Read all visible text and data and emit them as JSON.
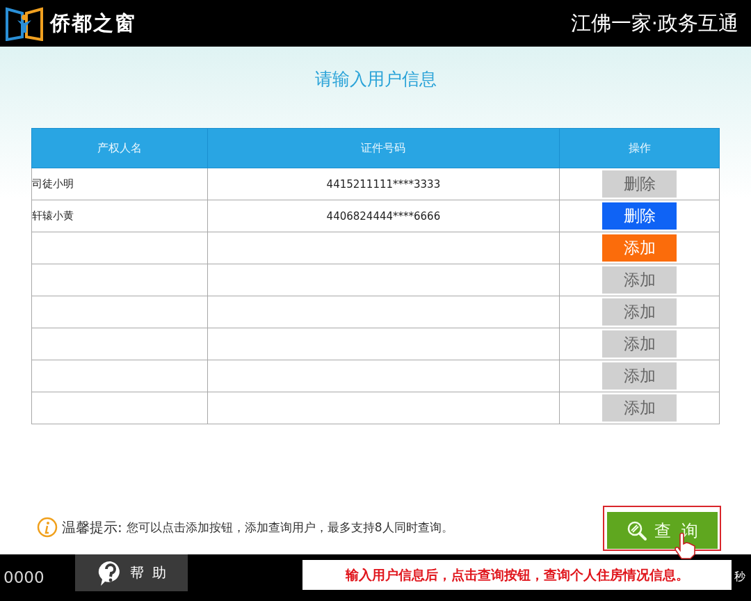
{
  "header": {
    "logo_text": "侨都之窗",
    "slogan": "江佛一家·政务互通"
  },
  "title": "请输入用户信息",
  "table": {
    "columns": [
      "产权人名",
      "证件号码",
      "操作"
    ],
    "rows": [
      {
        "name": "司徒小明",
        "id_number": "4415211111****3333",
        "action": {
          "label": "删除",
          "kind": "inactive"
        }
      },
      {
        "name": "轩辕小黄",
        "id_number": "4406824444****6666",
        "action": {
          "label": "删除",
          "kind": "delete"
        }
      },
      {
        "name": "",
        "id_number": "",
        "action": {
          "label": "添加",
          "kind": "add"
        }
      },
      {
        "name": "",
        "id_number": "",
        "action": {
          "label": "添加",
          "kind": "inactive"
        }
      },
      {
        "name": "",
        "id_number": "",
        "action": {
          "label": "添加",
          "kind": "inactive"
        }
      },
      {
        "name": "",
        "id_number": "",
        "action": {
          "label": "添加",
          "kind": "inactive"
        }
      },
      {
        "name": "",
        "id_number": "",
        "action": {
          "label": "添加",
          "kind": "inactive"
        }
      },
      {
        "name": "",
        "id_number": "",
        "action": {
          "label": "添加",
          "kind": "inactive"
        }
      }
    ]
  },
  "tip": {
    "label": "温馨提示:",
    "text": "您可以点击添加按钮，添加查询用户，最多支持8人同时查询。"
  },
  "search_button": {
    "label": "查  询"
  },
  "bottom_bar": {
    "counter": "0000",
    "help_button": "帮  助",
    "seconds_label": "秒"
  },
  "callout": "输入用户信息后，点击查询按钮，查询个人住房情况信息。"
}
